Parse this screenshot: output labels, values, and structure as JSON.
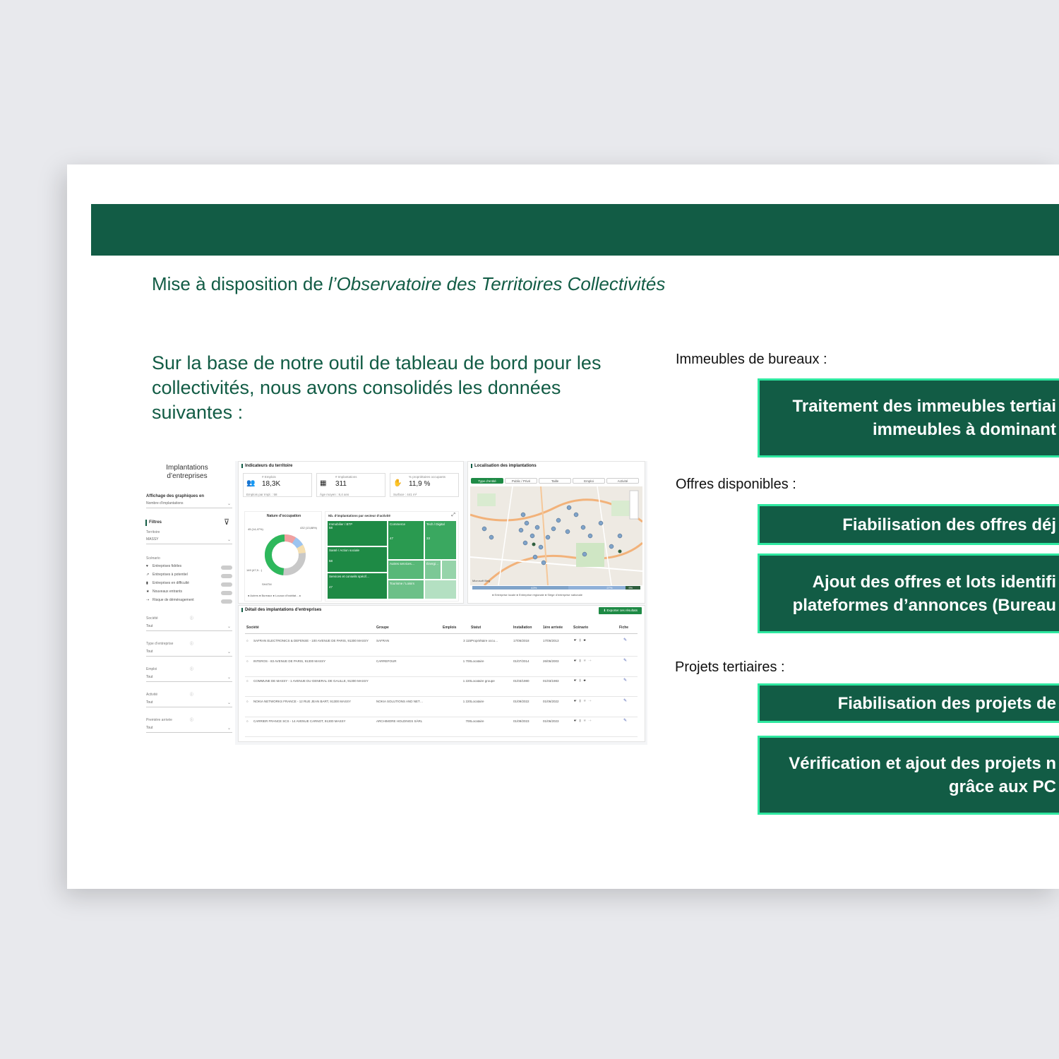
{
  "slide": {
    "subtitle_prefix": "Mise à disposition de ",
    "subtitle_italic": "l’Observatoire des Territoires Collectivités",
    "intro": "Sur la base de notre outil de tableau de bord pour les collectivités, nous avons consolidés les données suivantes :",
    "sections": [
      {
        "heading": "Immeubles de bureaux :",
        "boxes": [
          {
            "line1": "Traitement des immeubles tertiai",
            "line2": "immeubles à dominant"
          }
        ]
      },
      {
        "heading": "Offres disponibles :",
        "boxes": [
          {
            "line1": "Fiabilisation des offres déj",
            "line2": ""
          },
          {
            "line1": "Ajout des offres et lots identifi",
            "line2": "plateformes d’annonces (Bureau"
          }
        ]
      },
      {
        "heading": "Projets tertiaires :",
        "boxes": [
          {
            "line1": "Fiabilisation des projets de",
            "line2": ""
          },
          {
            "line1": "Vérification et ajout des projets n",
            "line2": "grâce aux PC"
          }
        ]
      }
    ]
  },
  "colors": {
    "brand_green": "#125c45",
    "accent_border": "#2ee8a0"
  },
  "dashboard": {
    "sidebar": {
      "title_line1": "Implantations",
      "title_line2": "d’entreprises",
      "display_label": "Affichage des graphiques en",
      "display_value": "Nombre d’implantations",
      "filters_label": "Filtres",
      "territory_label": "Territoire",
      "territory_value": "MASSY",
      "scenario_label": "Scénario",
      "scenarios": [
        {
          "icon": "heart-icon",
          "glyph": "♥",
          "label": "Entreprises fidèles"
        },
        {
          "icon": "chart-icon",
          "glyph": "↗",
          "label": "Entreprises à potentiel"
        },
        {
          "icon": "bars-icon",
          "glyph": "▮",
          "label": "Entreprises en difficulté"
        },
        {
          "icon": "star-icon",
          "glyph": "★",
          "label": "Nouveaux entrants"
        },
        {
          "icon": "move-icon",
          "glyph": "⇢",
          "label": "Risque de déménagement"
        }
      ],
      "filters": [
        {
          "label": "Société",
          "value": "Tout"
        },
        {
          "label": "Type d’entreprise",
          "value": "Tout"
        },
        {
          "label": "Emploi",
          "value": "Tout"
        },
        {
          "label": "Activité",
          "value": "Tout"
        },
        {
          "label": "Première arrivée",
          "value": "Tout"
        }
      ]
    },
    "indicators": {
      "title": "Indicateurs du territoire",
      "kpis": [
        {
          "icon": "people-icon",
          "glyph": "👥",
          "label": "# Emplois",
          "value": "18,3K",
          "sub": "Emplois par Impl. : 58"
        },
        {
          "icon": "building-icon",
          "glyph": "▦",
          "label": "# Implantations",
          "value": "311",
          "sub": "Âge moyen : 8,4 ans"
        },
        {
          "icon": "hand-icon",
          "glyph": "✋",
          "label": "% propriétaires occupants",
          "value": "11,9 %",
          "sub": "Surface : 441 m²"
        }
      ],
      "donut_title": "Nature d’occupation",
      "donut_labels": [
        "45 (14,47%)",
        "432 (13,88%)",
        "149 (47,9…)",
        "SH4TM"
      ],
      "donut_legend": "● Autres ● Bureaux ● Locaux d’habitat… ▸",
      "treemap_title": "Nb. d’implantations par secteur d’activité",
      "treemap_cells": [
        {
          "label": "Immobilier / BTP",
          "value": "58"
        },
        {
          "label": "Commerce",
          "value": "47"
        },
        {
          "label": "Tech / Digital",
          "value": "33"
        },
        {
          "label": "Santé / Action sociale",
          "value": "58"
        },
        {
          "label": "Autres services…",
          "value": ""
        },
        {
          "label": "Énergi…",
          "value": ""
        },
        {
          "label": "Services et conseils spécif…",
          "value": "47"
        },
        {
          "label": "Tourisme / Loisirs",
          "value": ""
        }
      ]
    },
    "map": {
      "title": "Localisation des implantations",
      "tabs": [
        "Type d’entité",
        "Public / Privé",
        "Taille",
        "Emploi",
        "Activité"
      ],
      "legend": "● Entreprise locale ● Entreprise régionale ● Siège d’entreprise nationale",
      "bar_values": [
        "43%",
        "27%",
        "9%"
      ],
      "watermark": "Microsoft Bing"
    },
    "table": {
      "title": "Détail des implantations d’entreprises",
      "export_label": "Exporter ces résultats",
      "columns": [
        "Société",
        "Groupe",
        "Emplois",
        "Statut",
        "Installation",
        "1ère arrivée",
        "Scénario",
        "Fiche"
      ],
      "rows": [
        {
          "societe": "SAFRAN ELECTRONICS & DEFENSE - 100 AVENUE DE PARIS, 91300 MASSY",
          "groupe": "SAFRAN",
          "emplois": "3 115",
          "statut": "Propriétaire occu…",
          "installation": "17/06/2018",
          "arrivee": "17/06/2013"
        },
        {
          "societe": "INTEROS - 83 AVENUE DE PARIS, 91300 MASSY",
          "groupe": "CARREFOUR",
          "emplois": "1 700",
          "statut": "Locataire",
          "installation": "01/07/2014",
          "arrivee": "26/06/2003"
        },
        {
          "societe": "COMMUNE DE MASSY - 1 AVENUE DU GENERAL DE GAULLE, 91300 MASSY",
          "groupe": "",
          "emplois": "1 220",
          "statut": "Locataire groupe",
          "installation": "01/03/1980",
          "arrivee": "01/03/1983"
        },
        {
          "societe": "NOKIA NETWORKS FRANCE - 12 RUE JEAN BART, 91300 MASSY",
          "groupe": "NOKIA SOLUTIONS AND NET…",
          "emplois": "1 220",
          "statut": "Locataire",
          "installation": "01/09/2022",
          "arrivee": "01/06/2022"
        },
        {
          "societe": "CARRIER FRANCE SCS - 14 AVENUE CARNOT, 91300 MASSY",
          "groupe": "ARCHIMORE HOLDINGS SÀRL",
          "emplois": "700",
          "statut": "Locataire",
          "installation": "01/09/2023",
          "arrivee": "01/06/2023"
        }
      ]
    }
  }
}
